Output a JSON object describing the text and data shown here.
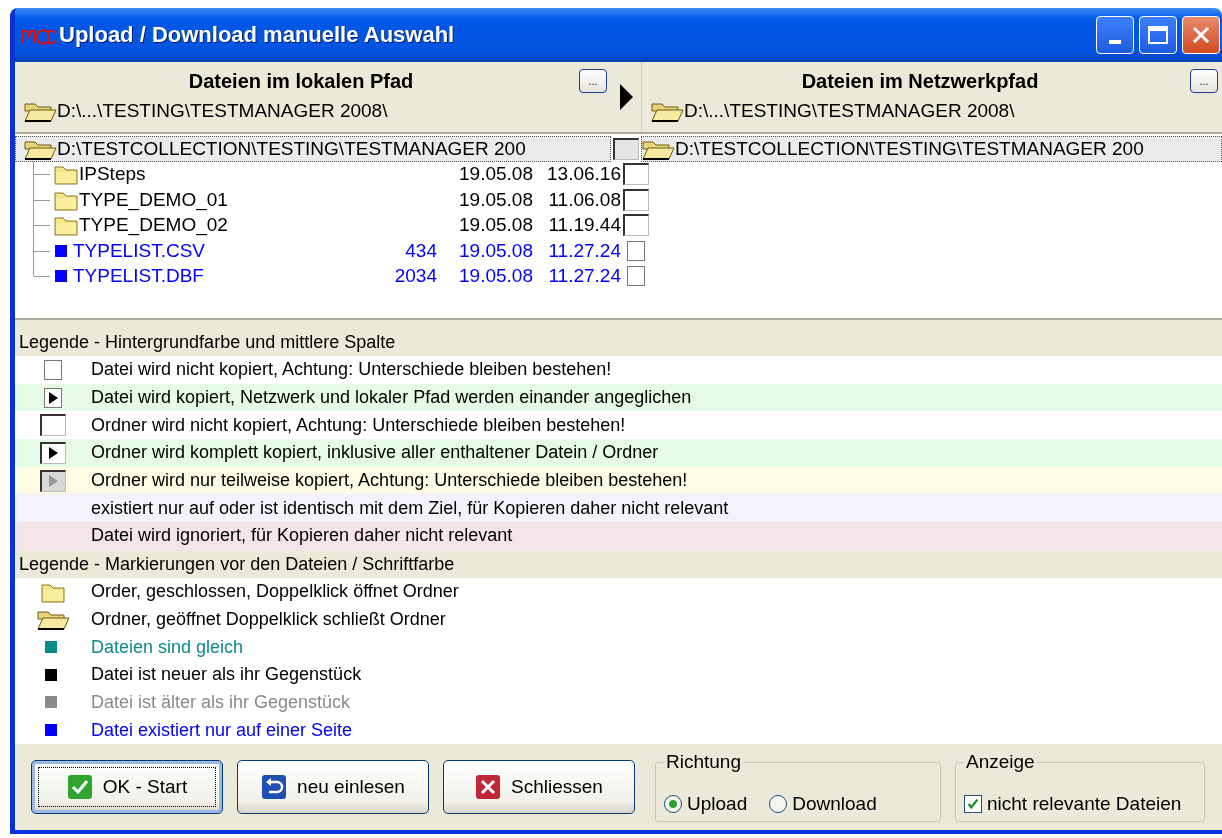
{
  "window": {
    "title": "Upload / Download manuelle Auswahl"
  },
  "local_pane": {
    "title": "Dateien im lokalen Pfad",
    "browse_button": "...",
    "path": "D:\\...\\TESTING\\TESTMANAGER 2008\\"
  },
  "network_pane": {
    "title": "Dateien im Netzwerkpfad",
    "browse_button": "...",
    "path": "D:\\...\\TESTING\\TESTMANAGER 2008\\"
  },
  "tree": {
    "local_root": {
      "text": "D:\\TESTCOLLECTION\\TESTING\\TESTMANAGER 200",
      "expanded": true,
      "selected": true,
      "checked": false,
      "children": [
        {
          "kind": "folder",
          "name": "IPSteps",
          "date": "19.05.08",
          "time": "13.06.16",
          "expanded": false,
          "checked": false,
          "color": "#000000"
        },
        {
          "kind": "folder",
          "name": "TYPE_DEMO_01",
          "date": "19.05.08",
          "time": "11.06.08",
          "expanded": false,
          "checked": false,
          "color": "#000000"
        },
        {
          "kind": "folder",
          "name": "TYPE_DEMO_02",
          "date": "19.05.08",
          "time": "11.19.44",
          "expanded": false,
          "checked": false,
          "color": "#000000"
        },
        {
          "kind": "file",
          "name": "TYPELIST.CSV",
          "size": "434",
          "date": "19.05.08",
          "time": "11.27.24",
          "checked": false,
          "color": "#0000ff"
        },
        {
          "kind": "file",
          "name": "TYPELIST.DBF",
          "size": "2034",
          "date": "19.05.08",
          "time": "11.27.24",
          "checked": false,
          "color": "#0000ff"
        }
      ]
    },
    "network_root": {
      "text": "D:\\TESTCOLLECTION\\TESTING\\TESTMANAGER 200",
      "expanded": true,
      "selected": true
    }
  },
  "legend": [
    {
      "title": "Legende - Hintergrundfarbe und mittlere Spalte",
      "entries": [
        {
          "kind": "file",
          "checked": false,
          "color": "#ffffff",
          "text": "Datei wird nicht kopiert, Achtung: Unterschiede bleiben bestehen!"
        },
        {
          "kind": "file",
          "checked": true,
          "color": "#e6fbe6",
          "text": "Datei wird kopiert, Netzwerk und lokaler Pfad werden einander angeglichen"
        },
        {
          "kind": "folder",
          "checked": false,
          "color": "#ffffff",
          "text": "Ordner wird nicht kopiert, Achtung: Unterschiede bleiben bestehen!"
        },
        {
          "kind": "folder",
          "checked": true,
          "color": "#e6fbe6",
          "text": "Ordner wird komplett kopiert, inklusive aller enthaltener Datein / Ordner"
        },
        {
          "kind": "folder-partial",
          "checked": true,
          "color": "#fdfbe3",
          "text": "Ordner wird nur teilweise kopiert, Achtung: Unterschiede bleiben bestehen!"
        },
        {
          "kind": "none",
          "color": "#f3f3fc",
          "text": "existiert nur auf oder ist identisch mit dem Ziel, für Kopieren daher nicht relevant"
        },
        {
          "kind": "none",
          "color": "#f5e4ea",
          "text": "Datei wird ignoriert, für Kopieren daher nicht relevant"
        }
      ]
    },
    {
      "title": "Legende - Markierungen vor den Dateien / Schriftfarbe",
      "entries": [
        {
          "kind": "folder-closed",
          "color": "#000000",
          "text": "Order, geschlossen, Doppelklick öffnet Ordner"
        },
        {
          "kind": "folder-open",
          "color": "#000000",
          "text": "Ordner, geöffnet Doppelklick schließt Ordner"
        },
        {
          "kind": "square",
          "color": "#0b8a8a",
          "text": "Dateien sind gleich"
        },
        {
          "kind": "square",
          "color": "#000000",
          "text": "Datei ist neuer als ihr Gegenstück"
        },
        {
          "kind": "square",
          "color": "#8a8a8a",
          "text": "Datei ist älter als ihr Gegenstück"
        },
        {
          "kind": "square",
          "color": "#0000ff",
          "text": "Datei existiert nur auf einer Seite"
        }
      ]
    }
  ],
  "buttons": [
    {
      "kind": "ok",
      "label": "OK - Start",
      "focused": true
    },
    {
      "kind": "refresh",
      "label": "neu einlesen",
      "focused": false
    },
    {
      "kind": "close",
      "label": "Schliessen",
      "focused": false
    }
  ],
  "direction": {
    "title": "Richtung",
    "options": [
      {
        "label": "Upload",
        "selected": true
      },
      {
        "label": "Download",
        "selected": false
      }
    ]
  },
  "display": {
    "title": "Anzeige",
    "label": "nicht relevante Dateien",
    "checked": true
  }
}
